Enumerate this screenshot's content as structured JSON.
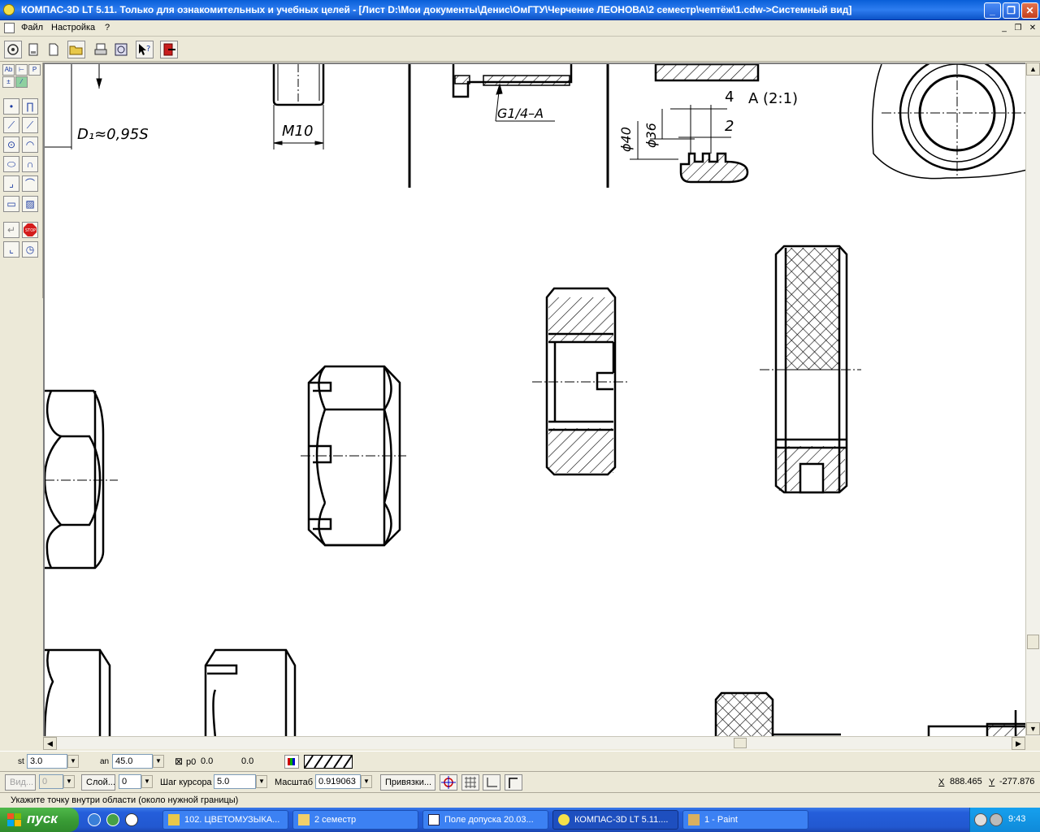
{
  "window": {
    "title": "КОМПАС-3D LT 5.11. Только для ознакомительных и учебных целей - [Лист D:\\Мои документы\\Денис\\ОмГТУ\\Черчение ЛЕОНОВА\\2 семестр\\чептёж\\1.cdw->Системный вид]",
    "btn_min": "_",
    "btn_max": "❐",
    "btn_close": "✕"
  },
  "menu": {
    "file": "Файл",
    "settings": "Настройка",
    "help": "?"
  },
  "toolbar": {
    "icons": [
      "properties-icon",
      "print-preview-icon",
      "new-sheet-icon",
      "open-icon",
      "print-icon",
      "library-icon",
      "help-cursor-icon",
      "exit-icon"
    ]
  },
  "drawing": {
    "annotation_d1": "D₁≈0,95S",
    "annotation_m10": "M10",
    "annotation_g14": "G1/4–A",
    "annotation_dim4": "4",
    "annotation_view_a": "A (2:1)",
    "annotation_dim2": "2",
    "annotation_phi40": "ϕ40",
    "annotation_phi36": "ϕ36"
  },
  "propbar": {
    "st_label": "st",
    "st_value": "3.0",
    "an_label": "an",
    "an_value": "45.0",
    "p0_label": "р0",
    "p0_value": "0.0",
    "extra_value": "0.0"
  },
  "statbar": {
    "view_label": "Вид...",
    "view_value": "0",
    "layer_label": "Слой...",
    "layer_value": "0",
    "step_label": "Шаг курсора",
    "step_value": "5.0",
    "scale_label": "Масштаб",
    "scale_value": "0.919063",
    "snaps_label": "Привязки...",
    "x_label": "X",
    "x_value": "888.465",
    "y_label": "Y",
    "y_value": "-277.876"
  },
  "hint": "Укажите точку внутри области (около нужной границы)",
  "taskbar": {
    "start_label": "пуск",
    "tasks": [
      "102. ЦВЕТОМУЗЫКА...",
      "2 семестр",
      "Поле допуска 20.03...",
      "КОМПАС-3D LT 5.11....",
      "1 - Paint"
    ],
    "clock": "9:43"
  },
  "colors": {
    "title_blue": "#0a5fd8",
    "taskbar_blue": "#245edb",
    "start_green": "#3a9d36",
    "stop_red": "#d41c1c"
  }
}
